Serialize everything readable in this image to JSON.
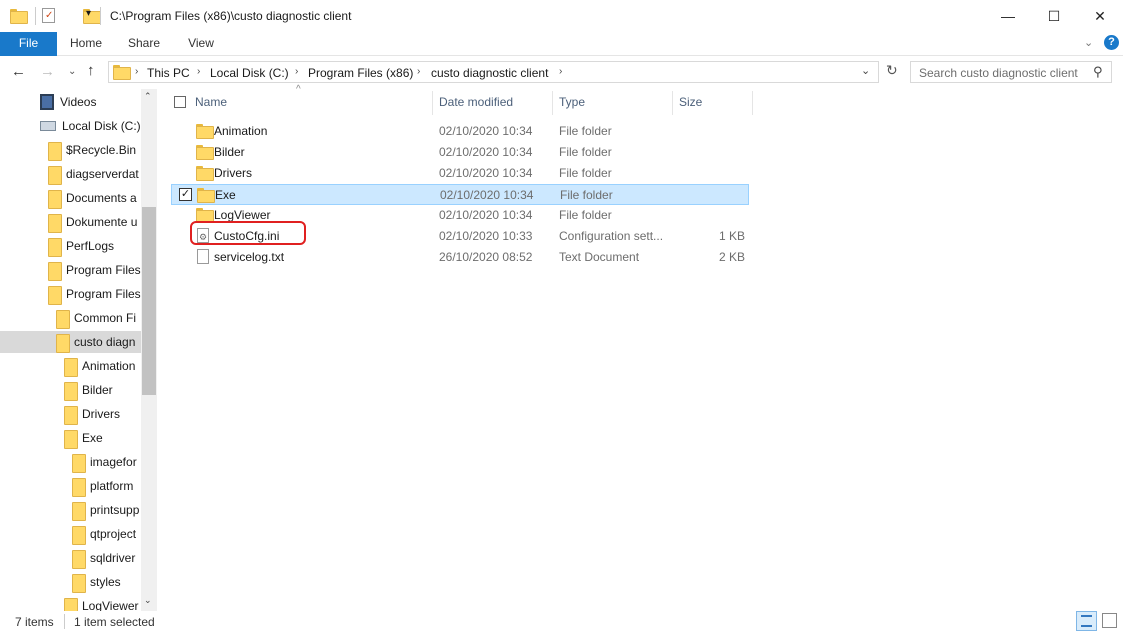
{
  "window": {
    "title": "C:\\Program Files (x86)\\custo diagnostic client",
    "minimize": "—",
    "maximize": "☐",
    "close": "✕"
  },
  "ribbon": {
    "tabs": [
      "File",
      "Home",
      "Share",
      "View"
    ],
    "help": "?"
  },
  "address": {
    "crumbs": [
      "This PC",
      "Local Disk (C:)",
      "Program Files (x86)",
      "custo diagnostic client"
    ],
    "search_placeholder": "Search custo diagnostic client"
  },
  "nav": {
    "items": [
      {
        "label": "Videos",
        "icon": "videos-icon"
      },
      {
        "label": "Local Disk (C:)",
        "icon": "drive-icon"
      },
      {
        "label": "$Recycle.Bin",
        "icon": "folder-icon"
      },
      {
        "label": "diagserverdat",
        "icon": "folder-icon"
      },
      {
        "label": "Documents a",
        "icon": "folder-shortcut-icon"
      },
      {
        "label": "Dokumente u",
        "icon": "folder-shortcut-icon"
      },
      {
        "label": "PerfLogs",
        "icon": "folder-icon"
      },
      {
        "label": "Program Files",
        "icon": "folder-icon"
      },
      {
        "label": "Program Files",
        "icon": "folder-icon"
      },
      {
        "label": "Common Fi",
        "icon": "folder-icon"
      },
      {
        "label": "custo diagn",
        "icon": "folder-icon",
        "selected": true
      },
      {
        "label": "Animation",
        "icon": "folder-icon"
      },
      {
        "label": "Bilder",
        "icon": "folder-icon"
      },
      {
        "label": "Drivers",
        "icon": "folder-icon"
      },
      {
        "label": "Exe",
        "icon": "folder-icon"
      },
      {
        "label": "imagefor",
        "icon": "folder-icon"
      },
      {
        "label": "platform",
        "icon": "folder-icon"
      },
      {
        "label": "printsupp",
        "icon": "folder-icon"
      },
      {
        "label": "qtproject",
        "icon": "folder-icon"
      },
      {
        "label": "sqldriver",
        "icon": "folder-icon"
      },
      {
        "label": "styles",
        "icon": "folder-icon"
      },
      {
        "label": "LogViewer",
        "icon": "folder-icon"
      }
    ]
  },
  "columns": {
    "name": "Name",
    "date": "Date modified",
    "type": "Type",
    "size": "Size"
  },
  "files": [
    {
      "name": "Animation",
      "date": "02/10/2020 10:34",
      "type": "File folder",
      "size": "",
      "icon": "folder-icon"
    },
    {
      "name": "Bilder",
      "date": "02/10/2020 10:34",
      "type": "File folder",
      "size": "",
      "icon": "folder-icon"
    },
    {
      "name": "Drivers",
      "date": "02/10/2020 10:34",
      "type": "File folder",
      "size": "",
      "icon": "folder-icon"
    },
    {
      "name": "Exe",
      "date": "02/10/2020 10:34",
      "type": "File folder",
      "size": "",
      "icon": "folder-icon",
      "selected": true
    },
    {
      "name": "LogViewer",
      "date": "02/10/2020 10:34",
      "type": "File folder",
      "size": "",
      "icon": "folder-icon"
    },
    {
      "name": "CustoCfg.ini",
      "date": "02/10/2020 10:33",
      "type": "Configuration sett...",
      "size": "1 KB",
      "icon": "config-file-icon",
      "highlighted": true
    },
    {
      "name": "servicelog.txt",
      "date": "26/10/2020 08:52",
      "type": "Text Document",
      "size": "2 KB",
      "icon": "text-file-icon"
    }
  ],
  "status": {
    "count": "7 items",
    "selection": "1 item selected"
  },
  "colors": {
    "file_tab": "#1979ca",
    "selection": "#cce8ff",
    "highlight_outline": "#e02020"
  }
}
